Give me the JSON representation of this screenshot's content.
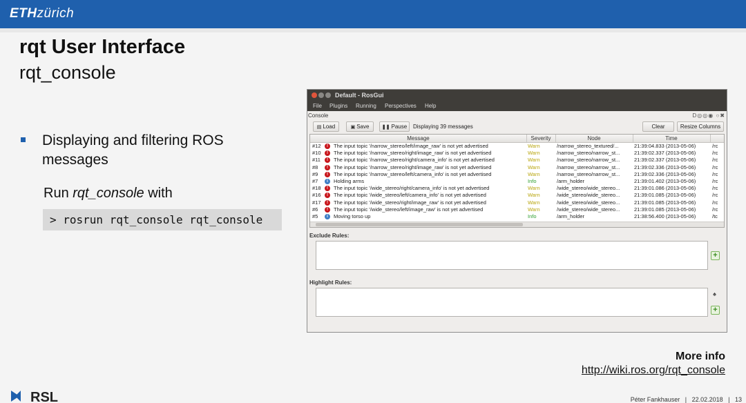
{
  "slide": {
    "brand_bold": "ETH",
    "brand_rest": "zürich",
    "title": "rqt User Interface",
    "subtitle": "rqt_console",
    "bullet": "Displaying and filtering ROS messages",
    "run_prefix": "Run ",
    "run_italic": "rqt_console",
    "run_suffix": " with",
    "code": "> rosrun rqt_console rqt_console",
    "more_info": "More info",
    "more_link": "http://wiki.ros.org/rqt_console",
    "footer_logo": "RSL",
    "footer": "Péter Fankhauser   |   22.02.2018   |   13",
    "accent": "#1f60ad"
  },
  "window": {
    "title": "Default - RosGui",
    "menu": [
      "File",
      "Plugins",
      "Running",
      "Perspectives",
      "Help"
    ],
    "console_label": "Console",
    "dock_icons": "D◎◎◉ ○✖",
    "toolbar": {
      "load": "Load",
      "save": "Save",
      "pause": "Pause",
      "status": "Displaying 39 messages",
      "clear": "Clear",
      "resize": "Resize Columns"
    },
    "columns": [
      "Message",
      "Severity",
      "Node",
      "Time"
    ],
    "rows": [
      {
        "id": "#12",
        "level": "warn",
        "message": "The input topic '/narrow_stereo/left/image_raw' is not yet advertised",
        "severity": "Warn",
        "node": "/narrow_stereo_textured/...",
        "time": "21:39:04.833 (2013-05-06)",
        "topics": "/rc"
      },
      {
        "id": "#10",
        "level": "warn",
        "message": "The input topic '/narrow_stereo/right/image_raw' is not yet advertised",
        "severity": "Warn",
        "node": "/narrow_stereo/narrow_st...",
        "time": "21:39:02.337 (2013-05-06)",
        "topics": "/rc"
      },
      {
        "id": "#11",
        "level": "warn",
        "message": "The input topic '/narrow_stereo/right/camera_info' is not yet advertised",
        "severity": "Warn",
        "node": "/narrow_stereo/narrow_st...",
        "time": "21:39:02.337 (2013-05-06)",
        "topics": "/rc"
      },
      {
        "id": "#8",
        "level": "warn",
        "message": "The input topic '/narrow_stereo/right/image_raw' is not yet advertised",
        "severity": "Warn",
        "node": "/narrow_stereo/narrow_st...",
        "time": "21:39:02.336 (2013-05-06)",
        "topics": "/rc"
      },
      {
        "id": "#9",
        "level": "warn",
        "message": "The input topic '/narrow_stereo/left/camera_info' is not yet advertised",
        "severity": "Warn",
        "node": "/narrow_stereo/narrow_st...",
        "time": "21:39:02.336 (2013-05-06)",
        "topics": "/rc"
      },
      {
        "id": "#7",
        "level": "info",
        "message": "Holding arms",
        "severity": "Info",
        "node": "/arm_holder",
        "time": "21:39:01.402 (2013-05-06)",
        "topics": "/rc"
      },
      {
        "id": "#18",
        "level": "warn",
        "message": "The input topic '/wide_stereo/right/camera_info' is not yet advertised",
        "severity": "Warn",
        "node": "/wide_stereo/wide_stereo...",
        "time": "21:39:01.086 (2013-05-06)",
        "topics": "/rc"
      },
      {
        "id": "#16",
        "level": "warn",
        "message": "The input topic '/wide_stereo/left/camera_info' is not yet advertised",
        "severity": "Warn",
        "node": "/wide_stereo/wide_stereo...",
        "time": "21:39:01.085 (2013-05-06)",
        "topics": "/rc"
      },
      {
        "id": "#17",
        "level": "warn",
        "message": "The input topic '/wide_stereo/right/image_raw' is not yet advertised",
        "severity": "Warn",
        "node": "/wide_stereo/wide_stereo...",
        "time": "21:39:01.085 (2013-05-06)",
        "topics": "/rc"
      },
      {
        "id": "#6",
        "level": "warn",
        "message": "The input topic '/wide_stereo/left/image_raw' is not yet advertised",
        "severity": "Warn",
        "node": "/wide_stereo/wide_stereo...",
        "time": "21:39:01.085 (2013-05-06)",
        "topics": "/rc"
      },
      {
        "id": "#5",
        "level": "info",
        "message": "Moving torso up",
        "severity": "Info",
        "node": "/arm_holder",
        "time": "21:38:56.400 (2013-05-06)",
        "topics": "/tc"
      }
    ],
    "exclude_label": "Exclude Rules:",
    "highlight_label": "Highlight Rules:"
  }
}
